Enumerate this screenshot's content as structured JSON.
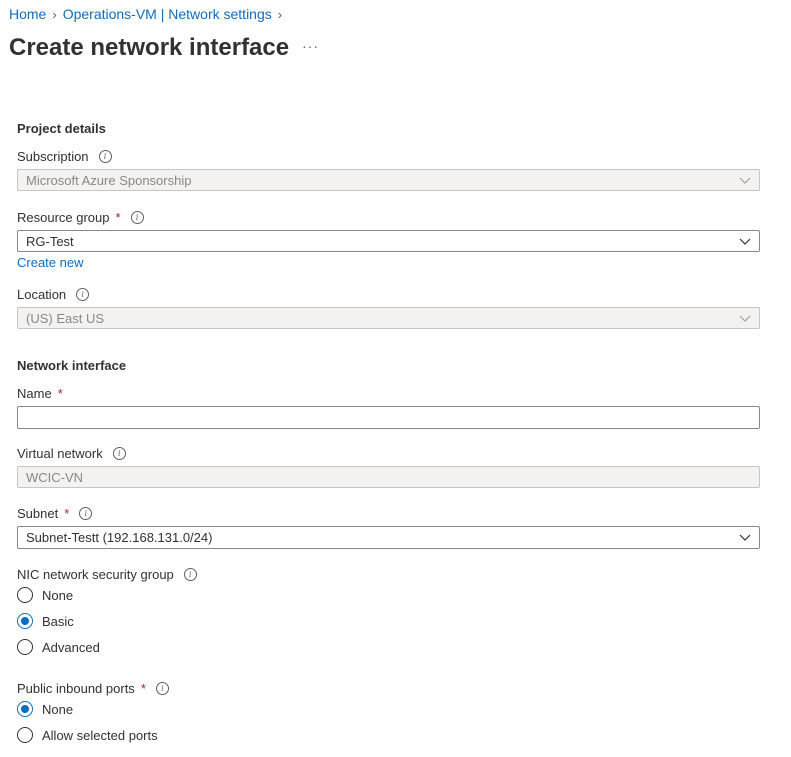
{
  "breadcrumb": {
    "items": [
      "Home",
      "Operations-VM | Network settings"
    ]
  },
  "page": {
    "title": "Create network interface",
    "more": "···"
  },
  "project": {
    "heading": "Project details",
    "subscription": {
      "label": "Subscription",
      "value": "Microsoft Azure Sponsorship"
    },
    "resource_group": {
      "label": "Resource group",
      "value": "RG-Test",
      "create_new": "Create new"
    },
    "location": {
      "label": "Location",
      "value": "(US) East US"
    }
  },
  "nic": {
    "heading": "Network interface",
    "name": {
      "label": "Name",
      "value": "",
      "placeholder": ""
    },
    "virtual_network": {
      "label": "Virtual network",
      "value": "WCIC-VN"
    },
    "subnet": {
      "label": "Subnet",
      "value": "Subnet-Testt (192.168.131.0/24)"
    },
    "nsg": {
      "label": "NIC network security group",
      "options": [
        "None",
        "Basic",
        "Advanced"
      ],
      "selected": "Basic"
    },
    "ports": {
      "label": "Public inbound ports",
      "options": [
        "None",
        "Allow selected ports"
      ],
      "selected": "None"
    }
  },
  "colors": {
    "accent": "#0f6cbd",
    "required": "#a4262c"
  },
  "required_mark": "*",
  "icons": {
    "info": "info-icon",
    "chevron": "chevron-down-icon"
  }
}
